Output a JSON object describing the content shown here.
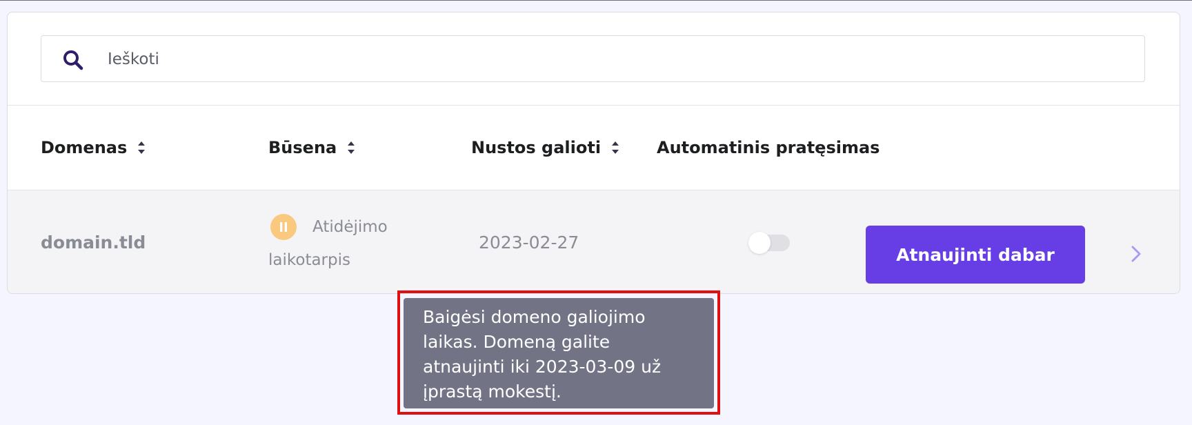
{
  "search": {
    "placeholder": "Ieškoti",
    "icon": "search-icon"
  },
  "table": {
    "columns": [
      {
        "label": "Domenas",
        "sortable": true
      },
      {
        "label": "Būsena",
        "sortable": true
      },
      {
        "label": "Nustos galioti",
        "sortable": true
      },
      {
        "label": "Automatinis pratęsimas",
        "sortable": false
      }
    ],
    "rows": [
      {
        "domain": "domain.tld",
        "status_line1": "Atidėjimo",
        "status_line2": "laikotarpis",
        "status_icon": "pause-icon",
        "expires": "2023-02-27",
        "auto_renew": false,
        "renew_label": "Atnaujinti dabar"
      }
    ]
  },
  "tooltip": {
    "line1": "Baigėsi domeno galiojimo",
    "line2": "laikas. Domeną galite",
    "line3": "atnaujinti iki 2023-03-09 už",
    "line4": "įprastą mokestį."
  },
  "colors": {
    "accent": "#673de6",
    "status_warning": "#f8c97f",
    "tooltip_bg": "#737386",
    "highlight": "#e01010"
  }
}
